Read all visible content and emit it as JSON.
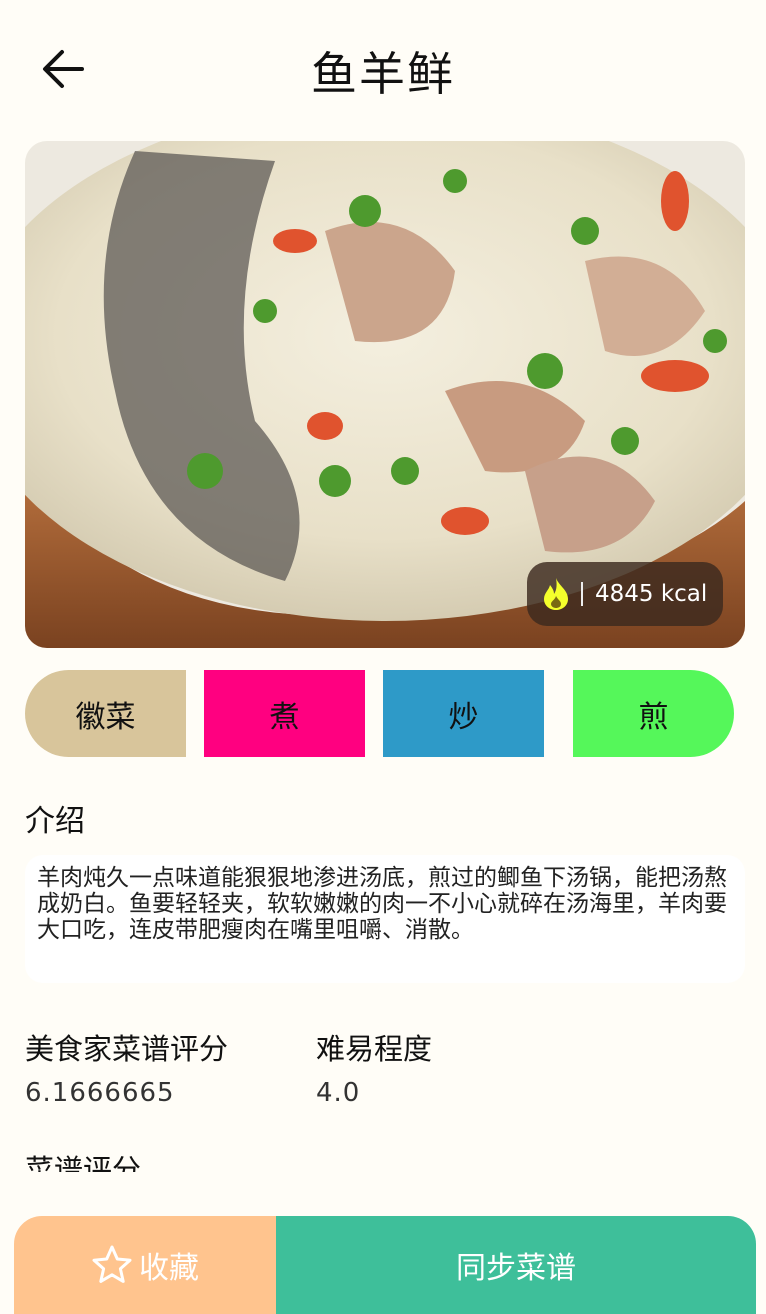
{
  "header": {
    "title": "鱼羊鲜"
  },
  "hero": {
    "kcal": "4845 kcal"
  },
  "tags": [
    {
      "label": "徽菜",
      "color": "#D8C59B"
    },
    {
      "label": "煮",
      "color": "#FF0080"
    },
    {
      "label": "炒",
      "color": "#2E9AC8"
    },
    {
      "label": "煎",
      "color": "#55F75A"
    }
  ],
  "intro": {
    "label": "介绍",
    "text": "羊肉炖久一点味道能狠狠地渗进汤底，煎过的鲫鱼下汤锅，能把汤熬成奶白。鱼要轻轻夹，软软嫩嫩的肉一不小心就碎在汤海里，羊肉要大口吃，连皮带肥瘦肉在嘴里咀嚼、消散。"
  },
  "metrics": {
    "gourmet_label": "美食家菜谱评分",
    "gourmet_value": "6.1666665",
    "difficulty_label": "难易程度",
    "difficulty_value": "4.0"
  },
  "recipe_rating_label": "菜谱评分",
  "bottom": {
    "favorite_label": "收藏",
    "sync_label": "同步菜谱"
  }
}
